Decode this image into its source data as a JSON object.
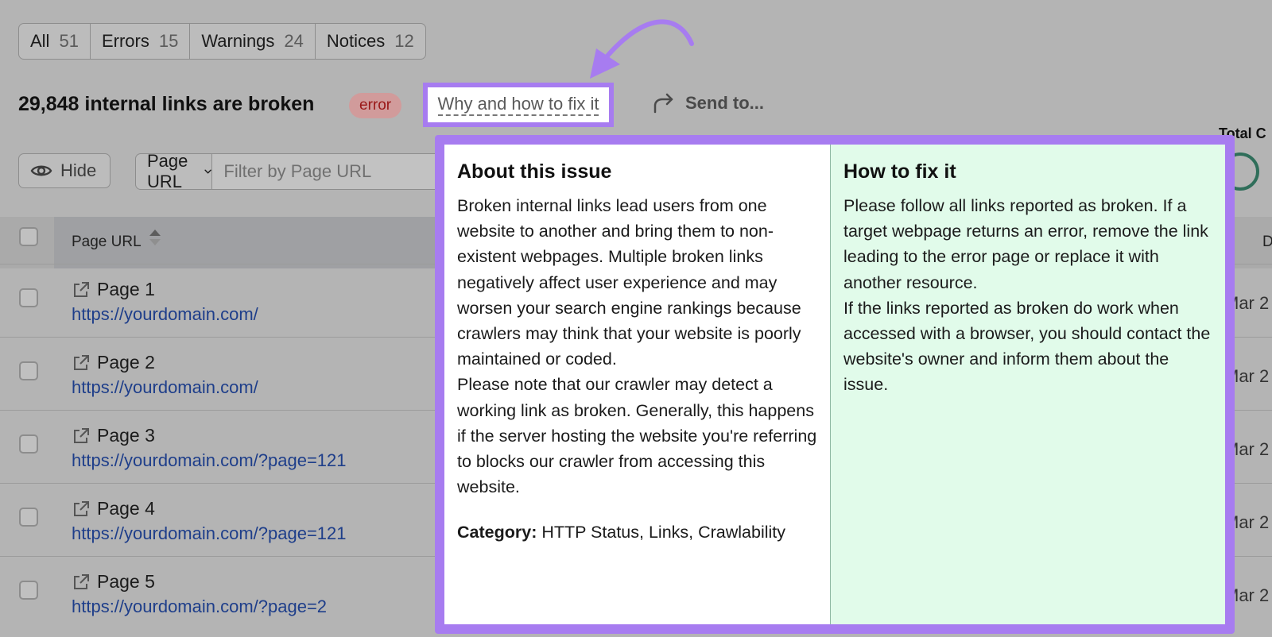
{
  "tabs": [
    {
      "label": "All",
      "count": "51"
    },
    {
      "label": "Errors",
      "count": "15"
    },
    {
      "label": "Warnings",
      "count": "24"
    },
    {
      "label": "Notices",
      "count": "12"
    }
  ],
  "issue": {
    "title": "29,848 internal links are broken",
    "badge": "error",
    "why_fix": "Why and how to fix it",
    "send_to": "Send to..."
  },
  "toolbar": {
    "hide_label": "Hide",
    "url_select": "Page URL",
    "filter_placeholder": "Filter by Page URL",
    "total_label": "Total C"
  },
  "table": {
    "header_url": "Page URL",
    "header_date": "D",
    "rows": [
      {
        "title": "Page 1",
        "url": "https://yourdomain.com/",
        "date": "Mar 2"
      },
      {
        "title": "Page 2",
        "url": "https://yourdomain.com/",
        "date": "Mar 2"
      },
      {
        "title": "Page 3",
        "url": "https://yourdomain.com/?page=121",
        "date": "Mar 2"
      },
      {
        "title": "Page 4",
        "url": "https://yourdomain.com/?page=121",
        "date": "Mar 2"
      },
      {
        "title": "Page 5",
        "url": "https://yourdomain.com/?page=2",
        "date": "Mar 2"
      }
    ]
  },
  "popover": {
    "about_title": "About this issue",
    "about_p1": "Broken internal links lead users from one website to another and bring them to non-existent webpages. Multiple broken links negatively affect user experience and may worsen your search engine rankings because crawlers may think that your website is poorly maintained or coded.",
    "about_p2": "Please note that our crawler may detect a working link as broken. Generally, this happens if the server hosting the website you're referring to blocks our crawler from accessing this website.",
    "category_label": "Category:",
    "category_value": "HTTP Status, Links, Crawlability",
    "fix_title": "How to fix it",
    "fix_p1": "Please follow all links reported as broken. If a target webpage returns an error, remove the link leading to the error page or replace it with another resource.",
    "fix_p2": "If the links reported as broken do work when accessed with a browser, you should contact the website's owner and inform them about the issue."
  },
  "colors": {
    "highlight": "#a77cf0",
    "fix_panel": "#e1fbea",
    "link": "#1e3e8a",
    "badge_text": "#9a1818"
  }
}
